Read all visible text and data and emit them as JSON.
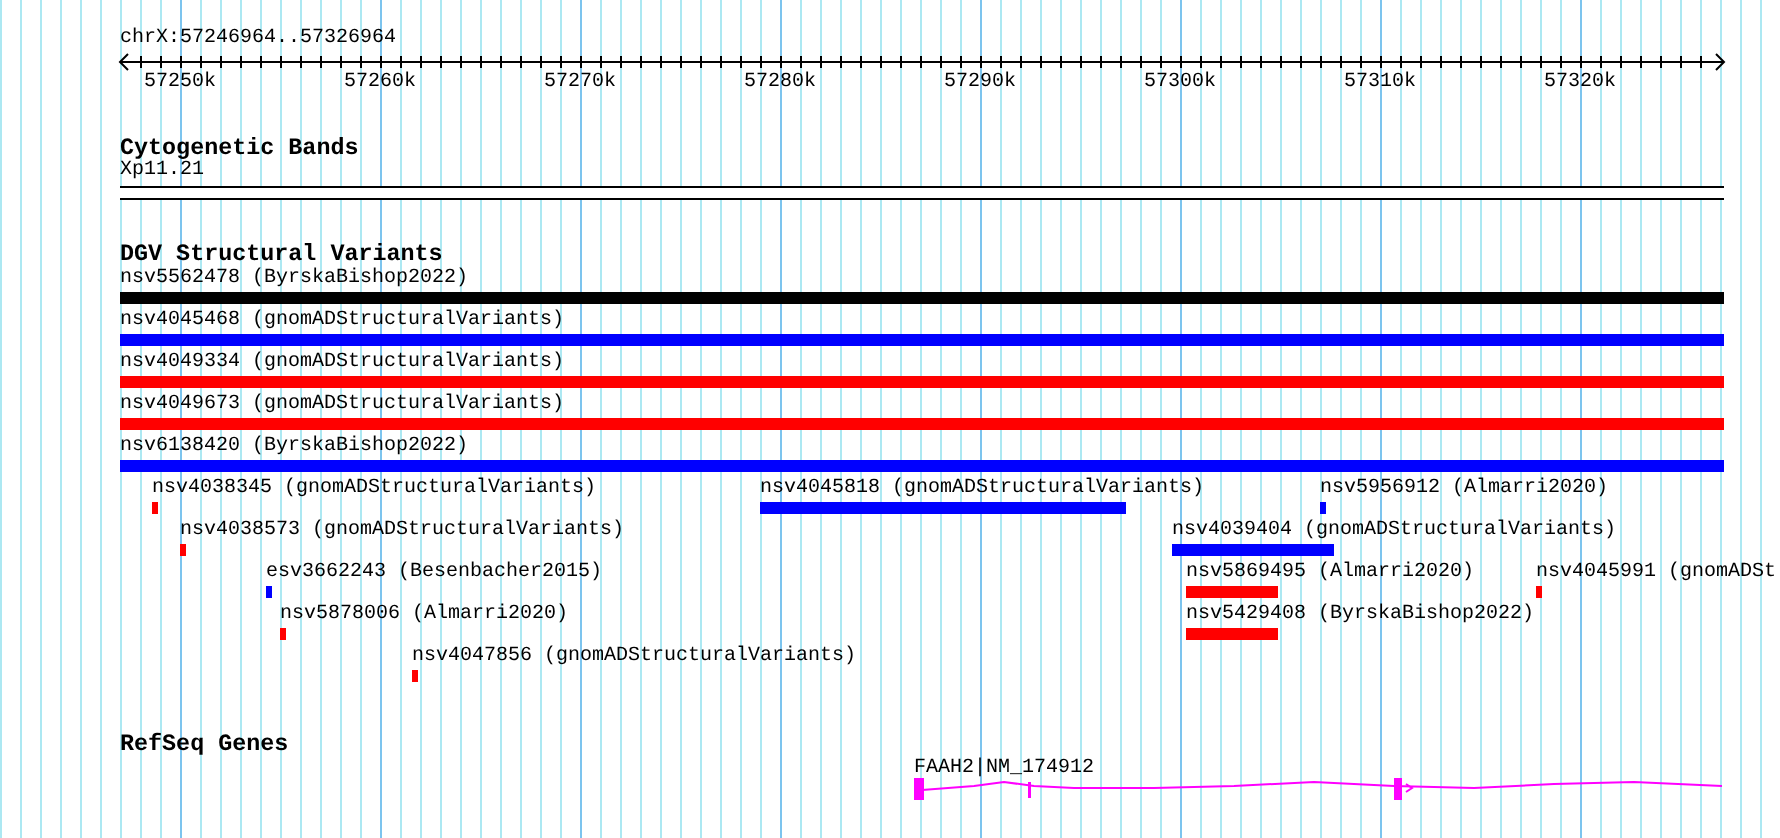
{
  "location": "chrX:57246964..57326964",
  "ruler": {
    "ticks": [
      "57250k",
      "57260k",
      "57270k",
      "57280k",
      "57290k",
      "57300k",
      "57310k",
      "57320k"
    ]
  },
  "cytogenetic_bands": {
    "title": "Cytogenetic Bands",
    "band": "Xp11.21"
  },
  "dgv": {
    "title": "DGV Structural Variants",
    "features": [
      {
        "label": "nsv5562478 (ByrskaBishop2022)",
        "color": "#000000"
      },
      {
        "label": "nsv4045468 (gnomADStructuralVariants)",
        "color": "#0000ff"
      },
      {
        "label": "nsv4049334 (gnomADStructuralVariants)",
        "color": "#ff0000"
      },
      {
        "label": "nsv4049673 (gnomADStructuralVariants)",
        "color": "#ff0000"
      },
      {
        "label": "nsv6138420 (ByrskaBishop2022)",
        "color": "#0000ff"
      },
      {
        "label": "nsv4038345 (gnomADStructuralVariants)",
        "color": "#ff0000"
      },
      {
        "label": "nsv4045818 (gnomADStructuralVariants)",
        "color": "#0000ff"
      },
      {
        "label": "nsv5956912 (Almarri2020)",
        "color": "#0000ff"
      },
      {
        "label": "nsv4038573 (gnomADStructuralVariants)",
        "color": "#ff0000"
      },
      {
        "label": "nsv4039404 (gnomADStructuralVariants)",
        "color": "#0000ff"
      },
      {
        "label": "esv3662243 (Besenbacher2015)",
        "color": "#0000ff"
      },
      {
        "label": "nsv5869495 (Almarri2020)",
        "color": "#ff0000"
      },
      {
        "label": "nsv4045991 (gnomADSt",
        "color": "#ff0000"
      },
      {
        "label": "nsv5878006 (Almarri2020)",
        "color": "#ff0000"
      },
      {
        "label": "nsv5429408 (ByrskaBishop2022)",
        "color": "#ff0000"
      },
      {
        "label": "nsv4047856 (gnomADStructuralVariants)",
        "color": "#ff0000"
      }
    ]
  },
  "refseq": {
    "title": "RefSeq Genes",
    "gene": "FAAH2|NM_174912"
  }
}
